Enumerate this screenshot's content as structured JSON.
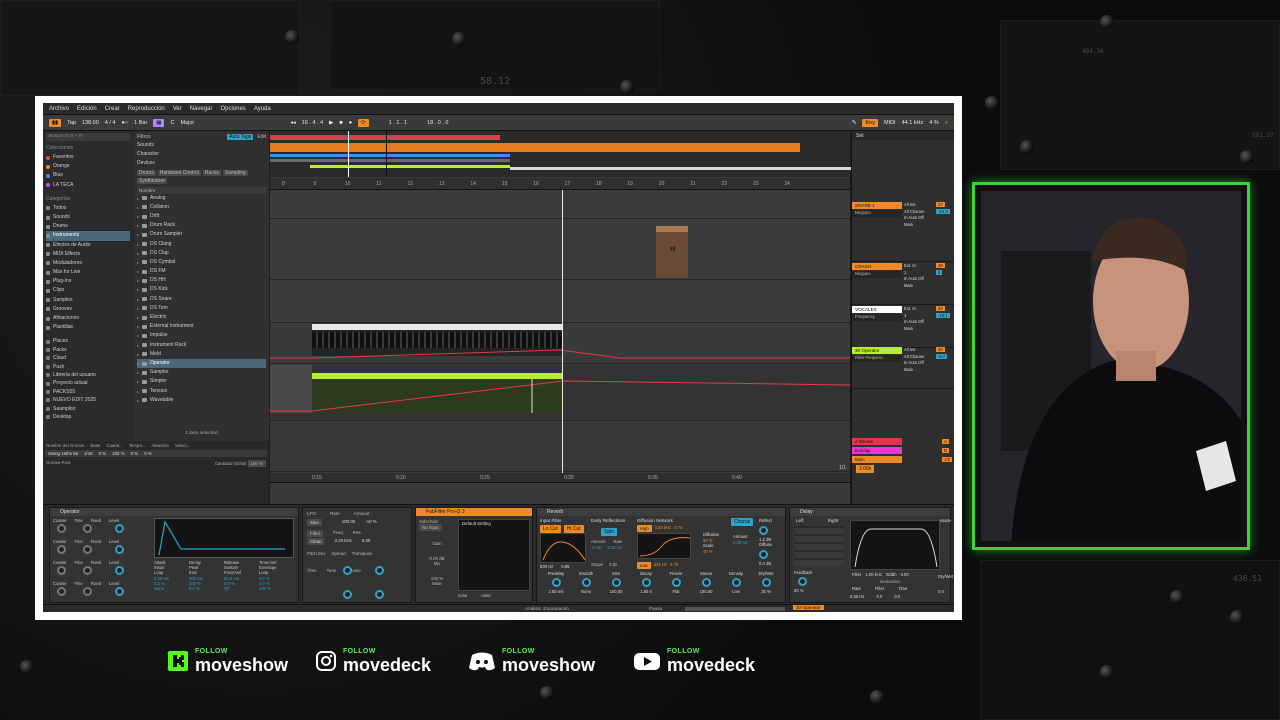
{
  "background": {
    "num_top": "58.12",
    "num_right_top": "484.36",
    "num_right_mid": "581.37",
    "num_right_bottom": "436.51"
  },
  "menu": [
    "Archivo",
    "Edición",
    "Crear",
    "Reproducción",
    "Ver",
    "Navegar",
    "Opciones",
    "Ayuda"
  ],
  "transport": {
    "tap": "Tap",
    "tempo": "138.00",
    "signature": "4 / 4",
    "bar": "1 Bar",
    "key": "C",
    "scale": "Major",
    "position": "16 . 4 . 4",
    "loop_start": "1 . 1 . 1",
    "loop_len": "18 . 0 . 0",
    "key_label": "Key",
    "midi_label": "MIDI",
    "sample_rate": "44.1 kHz",
    "cpu": "4 %"
  },
  "browser": {
    "search_placeholder": "Buscar (Ctrl + F)",
    "filters_label": "Filtros",
    "auto_tag": "Auto Tags",
    "edit": "Edit",
    "collections_title": "Colecciones",
    "collections": [
      {
        "label": "Favoritos",
        "color": "#e24b4b"
      },
      {
        "label": "Orange",
        "color": "#f08a24"
      },
      {
        "label": "Blue",
        "color": "#3d8ee6"
      },
      {
        "label": "LA TECA",
        "color": "#b15ee6"
      }
    ],
    "categories_title": "Categorías",
    "categories": [
      "Todos",
      "Sounds",
      "Drums",
      "Instruments",
      "Efectos de Audio",
      "MIDI Effects",
      "Moduladores",
      "Max for Live",
      "Plug-Ins",
      "Clips",
      "Samples",
      "Grooves",
      "Afinaciones",
      "Plantillas"
    ],
    "places_title": "Places",
    "places": [
      "Places",
      "Packs",
      "Cloud",
      "Push",
      "Librería del usuario",
      "Proyecto actual",
      "PACKS55",
      "NUEVO EDIT 2025",
      "Saamplist",
      "Desktop"
    ],
    "filters": [
      "Sounds",
      "Character",
      "Devices"
    ],
    "tags": [
      "Drums",
      "Hardware Control",
      "Racks",
      "Sampling",
      "Synthesizer"
    ],
    "name_header": "Nombre",
    "instruments": [
      "Analog",
      "Collision",
      "Drift",
      "Drum Rack",
      "Drum Sampler",
      "DS Clang",
      "DS Clap",
      "DS Cymbal",
      "DS FM",
      "DS HH",
      "DS Kick",
      "DS Snare",
      "DS Tom",
      "Electric",
      "External Instrument",
      "Impulse",
      "Instrument Rack",
      "Meld",
      "Operator",
      "Sampler",
      "Simpler",
      "Tension",
      "Wavetable"
    ],
    "selected_count": "1 item selected",
    "groove_headers": [
      "Nombre del Groove",
      "Base",
      "Cuanti...",
      "Tempo...",
      "Aleatorio",
      "Veloci..."
    ],
    "groove_row": [
      "Swing 16ths 66",
      "1/16",
      "0 %",
      "100 %",
      "0 %",
      "0 %"
    ],
    "groove_pool": "Groove Pool",
    "global_amount_label": "Cantidad Global",
    "global_amount": "100 %"
  },
  "ruler_top": [
    "8",
    "9",
    "10",
    "11",
    "12",
    "13",
    "14",
    "15",
    "16",
    "17",
    "18",
    "19",
    "20",
    "21",
    "22",
    "23",
    "24"
  ],
  "ruler_bottom": [
    "0:15",
    "0:20",
    "0:25",
    "0:30",
    "0:35",
    "0:40"
  ],
  "timecode_ratio": "1/1",
  "set_label": "Set",
  "tracks": [
    {
      "name": "SNARE 1",
      "color": "#f08a24",
      "in": "All Ins",
      "ch": "All Channe",
      "mon": "In Auto Off",
      "vol": "27",
      "pan": "-14.3",
      "route": "Ninguno",
      "out": "Main"
    },
    {
      "name": "CRASH",
      "color": "#f08a24",
      "in": "Ext. In",
      "ch": "1",
      "mon": "In Auto Off",
      "vol": "28",
      "pan": "0",
      "route": "Ninguno",
      "out": "Main"
    },
    {
      "name": "VOCALES",
      "color": "#ffffff",
      "in": "Ext. In",
      "ch": "1",
      "mon": "In Auto Off",
      "vol": "29",
      "pan": "-10.1",
      "route": "Frequency",
      "out": "Main"
    },
    {
      "name": "30 Operator",
      "color": "#b7ef2a",
      "in": "All Ins",
      "ch": "All Channe",
      "mon": "In Auto Off",
      "vol": "30",
      "pan": "-6.7",
      "route": "Filter Frequenc",
      "out": "Main"
    }
  ],
  "returns": [
    {
      "name": "A Reverb",
      "color": "#e8334c",
      "val": "A"
    },
    {
      "name": "B Delay",
      "color": "#e83ad0",
      "val": "B"
    },
    {
      "name": "Main",
      "color": "#f08a24",
      "val": "1/2"
    }
  ],
  "main_value": "3.00x",
  "devices": {
    "operator": {
      "title": "Operator",
      "rows": [
        "Coarse",
        "Fine",
        "Fixed",
        "Level"
      ],
      "values": [
        "1",
        "0",
        "",
        "0 dB"
      ],
      "env": [
        "Attack",
        "Decay",
        "Release",
        "Time<Vel",
        "Initial",
        "Peak",
        "Sustain",
        "Envelope",
        "Loop",
        "End",
        "Freq<Vel",
        "Loop"
      ],
      "envvals": [
        "0.00 ms",
        "600 ms",
        "50.0 ms",
        "0.0 %",
        "0.0 %",
        "100 %",
        "0.0 %",
        "0.0 %",
        "None",
        "0.0 %",
        "Off",
        "100 %"
      ],
      "lfo": "LFO",
      "filter": "Filter",
      "freq": "Freq",
      "res": "Res",
      "rate": "Rate",
      "amount": "Amount",
      "rate_val": "100.00",
      "amount_val": "-10 %",
      "freq_val": "3.29 kHz",
      "res_val": "0.00",
      "pitch_env": "Pitch Env",
      "spread": "Spread",
      "transpose": "Transpose",
      "time": "Time",
      "tone": "Tone",
      "volume": "Volume",
      "shaper": "Shaper",
      "shp_drive": "Shp.Drive",
      "dry_wet": "Dry/Wet",
      "sine": "Sine",
      "clean": "Clean"
    },
    "fabfilter": {
      "title": "FabFilter Pro-Q 3",
      "sidechain": "Sidechain",
      "no_input": "No Input",
      "gain": "Gain",
      "gain_val": "0.00 dB",
      "mix": "Mix",
      "mix_val": "100 %",
      "mute": "Mute",
      "preset": "Default Setting",
      "none1": "none",
      "none2": "none"
    },
    "reverb": {
      "title": "Reverb",
      "input_filter": "Input Filter",
      "lo_cut": "Lo Cut",
      "hi_cut": "Hi Cut",
      "early": "Early Reflections",
      "spin": "Spin",
      "amount": "Amount",
      "rate": "Rate",
      "amount_val": "17.50",
      "rate_val": "0.30 Hz",
      "diffusion": "Diffusion Network",
      "high": "High",
      "high_val": "4.50 kHz",
      "high_pct": "0.70",
      "low": "Low",
      "low_val": "331 Hz",
      "low_pct": "0.75",
      "chorus": "Chorus",
      "diffusion_lbl": "Diffusion",
      "diffusion_val": "60 %",
      "scale": "Scale",
      "scale_val": "40 %",
      "hz1": "830 Hz",
      "hz2": "5.85",
      "shape": "Shape",
      "shape_val": "0.50",
      "reflect": "Reflect",
      "reflect_val": "1.2 dB",
      "diffuse": "Diffuse",
      "diffuse_val": "0.0 dB",
      "predelay": "Predelay",
      "predelay_val": "2.50 ms",
      "smooth": "Smooth",
      "smooth_val": "None",
      "size": "Size",
      "size_val": "100.00",
      "decay": "Decay",
      "decay_val": "1.65 s",
      "freeze": "Freeze",
      "flat": "Flat",
      "cut": "Cut",
      "stereo": "Stereo",
      "stereo_val": "100.00",
      "density": "Density",
      "density_val": "Low",
      "drywet": "Dry/Wet",
      "drywet_val": "25 %"
    },
    "delay": {
      "title": "Delay",
      "left": "Left",
      "right": "Right",
      "sync": "Sync",
      "feedback": "Feedback",
      "feedback_val": "50 %",
      "filter": "Filter",
      "filter_val": "1.00 kHz",
      "width": "Width",
      "width_val": "8.00",
      "modulation": "Modulation",
      "rate": "Rate",
      "rate_val": "0.50 Hz",
      "mfilter": "Filter",
      "mfilter_val": "0.0",
      "mtime": "Time",
      "mtime_val": "0.0",
      "mode": "Mode",
      "drywet": "Dry/Wet",
      "drywet_val": "0.0"
    }
  },
  "status": {
    "analysis": "Análisis: Escaneando ...",
    "pause": "Pausa",
    "device": "30-Operator"
  },
  "social": [
    {
      "icon": "kick-icon",
      "follow": "FOLLOW",
      "handle": "moveshow"
    },
    {
      "icon": "instagram-icon",
      "follow": "FOLLOW",
      "handle": "movedeck"
    },
    {
      "icon": "discord-icon",
      "follow": "FOLLOW",
      "handle": "moveshow"
    },
    {
      "icon": "youtube-icon",
      "follow": "FOLLOW",
      "handle": "movedeck"
    }
  ],
  "colors": {
    "accent": "#f08a24",
    "lime": "#b7ef2a",
    "green_frame": "#39d43a",
    "knob": "#2ea3c7"
  }
}
